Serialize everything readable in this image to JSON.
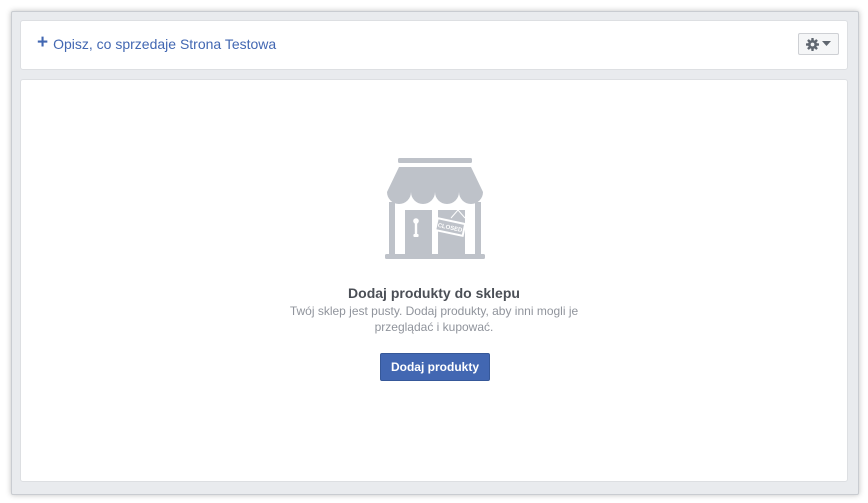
{
  "header": {
    "describe_link": "Opisz, co sprzedaje Strona Testowa",
    "plus_icon": "plus-icon",
    "settings_icon": "gear-icon"
  },
  "empty_state": {
    "icon": "store-closed-icon",
    "sign_text": "CLOSED",
    "title": "Dodaj produkty do sklepu",
    "description": "Twój sklep jest pusty. Dodaj produkty, aby inni mogli je przeglądać i kupować.",
    "button_label": "Dodaj produkty"
  },
  "colors": {
    "link": "#4267b2",
    "button": "#4267b2",
    "icon_gray": "#bec2c9",
    "title": "#4b4f56",
    "description": "#90949c"
  }
}
